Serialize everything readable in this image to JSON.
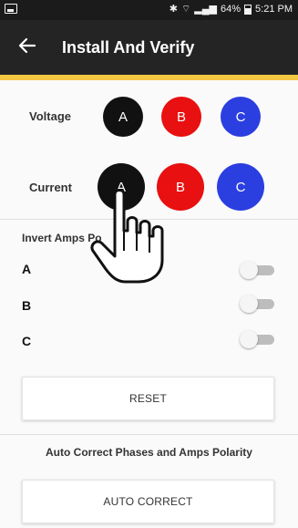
{
  "status_bar": {
    "battery": "64%",
    "time": "5:21 PM",
    "icons": [
      "image-icon",
      "bluetooth-icon",
      "wifi-icon",
      "signal-icon",
      "battery-icon"
    ]
  },
  "header": {
    "title": "Install And Verify",
    "back_icon": "back-arrow-icon"
  },
  "colors": {
    "accent": "#f5c842",
    "phase_a": "#111111",
    "phase_b": "#e81010",
    "phase_c": "#2b3fe0"
  },
  "voltage": {
    "label": "Voltage",
    "phases": [
      "A",
      "B",
      "C"
    ]
  },
  "current": {
    "label": "Current",
    "phases": [
      "A",
      "B",
      "C"
    ]
  },
  "invert_amps": {
    "title": "Invert Amps Po",
    "items": [
      {
        "label": "A",
        "on": false
      },
      {
        "label": "B",
        "on": false
      },
      {
        "label": "C",
        "on": false
      }
    ]
  },
  "reset_button": "RESET",
  "auto_correct": {
    "caption": "Auto Correct Phases and Amps Polarity",
    "button": "AUTO CORRECT"
  }
}
